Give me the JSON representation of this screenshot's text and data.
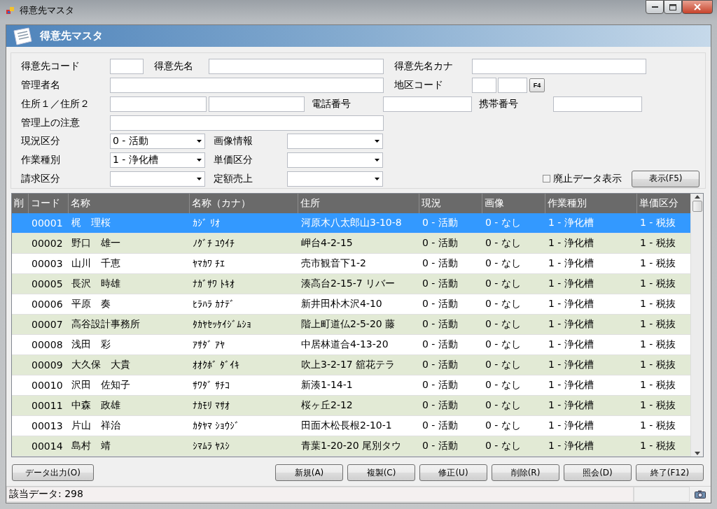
{
  "window": {
    "title": "得意先マスタ"
  },
  "banner": {
    "title": "得意先マスタ"
  },
  "form": {
    "customer_code": {
      "label": "得意先コード"
    },
    "customer_name": {
      "label": "得意先名"
    },
    "customer_kana": {
      "label": "得意先名カナ"
    },
    "manager_name": {
      "label": "管理者名"
    },
    "district_code": {
      "label": "地区コード",
      "button": "F4"
    },
    "address": {
      "label": "住所１／住所２"
    },
    "phone": {
      "label": "電話番号"
    },
    "mobile": {
      "label": "携帯番号"
    },
    "note": {
      "label": "管理上の注意"
    },
    "status": {
      "label": "現況区分",
      "value": "0 - 活動"
    },
    "image_info": {
      "label": "画像情報"
    },
    "work_type": {
      "label": "作業種別",
      "value": "1 - 浄化槽"
    },
    "price_class": {
      "label": "単価区分"
    },
    "billing_class": {
      "label": "請求区分"
    },
    "fixed_sales": {
      "label": "定額売上"
    },
    "show_retired": {
      "label": "廃止データ表示",
      "checked": false
    },
    "show_button": "表示(F5)"
  },
  "table": {
    "columns": [
      "削",
      "コード",
      "名称",
      "名称（カナ）",
      "住所",
      "現況",
      "画像",
      "作業種別",
      "単価区分"
    ],
    "rows": [
      {
        "selected": true,
        "cells": [
          "",
          "00001",
          "梶　理桜",
          "ｶｼﾞ ﾘｵ",
          "河原木八太郎山3-10-8",
          "0 - 活動",
          "0 - なし",
          "1 - 浄化槽",
          "1 - 税抜"
        ]
      },
      {
        "selected": false,
        "cells": [
          "",
          "00002",
          "野口　雄一",
          "ﾉｸﾞﾁ ﾕｳｲﾁ",
          "岬台4-2-15",
          "0 - 活動",
          "0 - なし",
          "1 - 浄化槽",
          "1 - 税抜"
        ]
      },
      {
        "selected": false,
        "cells": [
          "",
          "00003",
          "山川　千恵",
          "ﾔﾏｶﾜ ﾁｴ",
          "売市観音下1-2",
          "0 - 活動",
          "0 - なし",
          "1 - 浄化槽",
          "1 - 税抜"
        ]
      },
      {
        "selected": false,
        "cells": [
          "",
          "00005",
          "長沢　時雄",
          "ﾅｶﾞｻﾜ ﾄｷｵ",
          "湊高台2-15-7 リバー",
          "0 - 活動",
          "0 - なし",
          "1 - 浄化槽",
          "1 - 税抜"
        ]
      },
      {
        "selected": false,
        "cells": [
          "",
          "00006",
          "平原　奏",
          "ﾋﾗﾊﾗ ｶﾅﾃﾞ",
          "新井田朴木沢4-10",
          "0 - 活動",
          "0 - なし",
          "1 - 浄化槽",
          "1 - 税抜"
        ]
      },
      {
        "selected": false,
        "cells": [
          "",
          "00007",
          "高谷設計事務所",
          "ﾀｶﾔｾｯｹｲｼﾞﾑｼｮ",
          "階上町道仏2-5-20 藤",
          "0 - 活動",
          "0 - なし",
          "1 - 浄化槽",
          "1 - 税抜"
        ]
      },
      {
        "selected": false,
        "cells": [
          "",
          "00008",
          "浅田　彩",
          "ｱｻﾀﾞ ｱﾔ",
          "中居林道合4-13-20",
          "0 - 活動",
          "0 - なし",
          "1 - 浄化槽",
          "1 - 税抜"
        ]
      },
      {
        "selected": false,
        "cells": [
          "",
          "00009",
          "大久保　大貴",
          "ｵｵｸﾎﾞ ﾀﾞｲｷ",
          "吹上3-2-17 舘花テラ",
          "0 - 活動",
          "0 - なし",
          "1 - 浄化槽",
          "1 - 税抜"
        ]
      },
      {
        "selected": false,
        "cells": [
          "",
          "00010",
          "沢田　佐知子",
          "ｻﾜﾀﾞ ｻﾁｺ",
          "新湊1-14-1",
          "0 - 活動",
          "0 - なし",
          "1 - 浄化槽",
          "1 - 税抜"
        ]
      },
      {
        "selected": false,
        "cells": [
          "",
          "00011",
          "中森　政雄",
          "ﾅｶﾓﾘ ﾏｻｵ",
          "桜ヶ丘2-12",
          "0 - 活動",
          "0 - なし",
          "1 - 浄化槽",
          "1 - 税抜"
        ]
      },
      {
        "selected": false,
        "cells": [
          "",
          "00013",
          "片山　祥治",
          "ｶﾀﾔﾏ ｼｮｳｼﾞ",
          "田面木松長根2-10-1",
          "0 - 活動",
          "0 - なし",
          "1 - 浄化槽",
          "1 - 税抜"
        ]
      },
      {
        "selected": false,
        "cells": [
          "",
          "00014",
          "島村　靖",
          "ｼﾏﾑﾗ ﾔｽｼ",
          "青葉1-20-20 尾別タウ",
          "0 - 活動",
          "0 - なし",
          "1 - 浄化槽",
          "1 - 税抜"
        ]
      }
    ]
  },
  "actions": {
    "left": "データ出力(O)",
    "right": [
      "新規(A)",
      "複製(C)",
      "修正(U)",
      "削除(R)",
      "照会(D)",
      "終了(F12)"
    ]
  },
  "status_bar": {
    "text": "該当データ: 298"
  }
}
